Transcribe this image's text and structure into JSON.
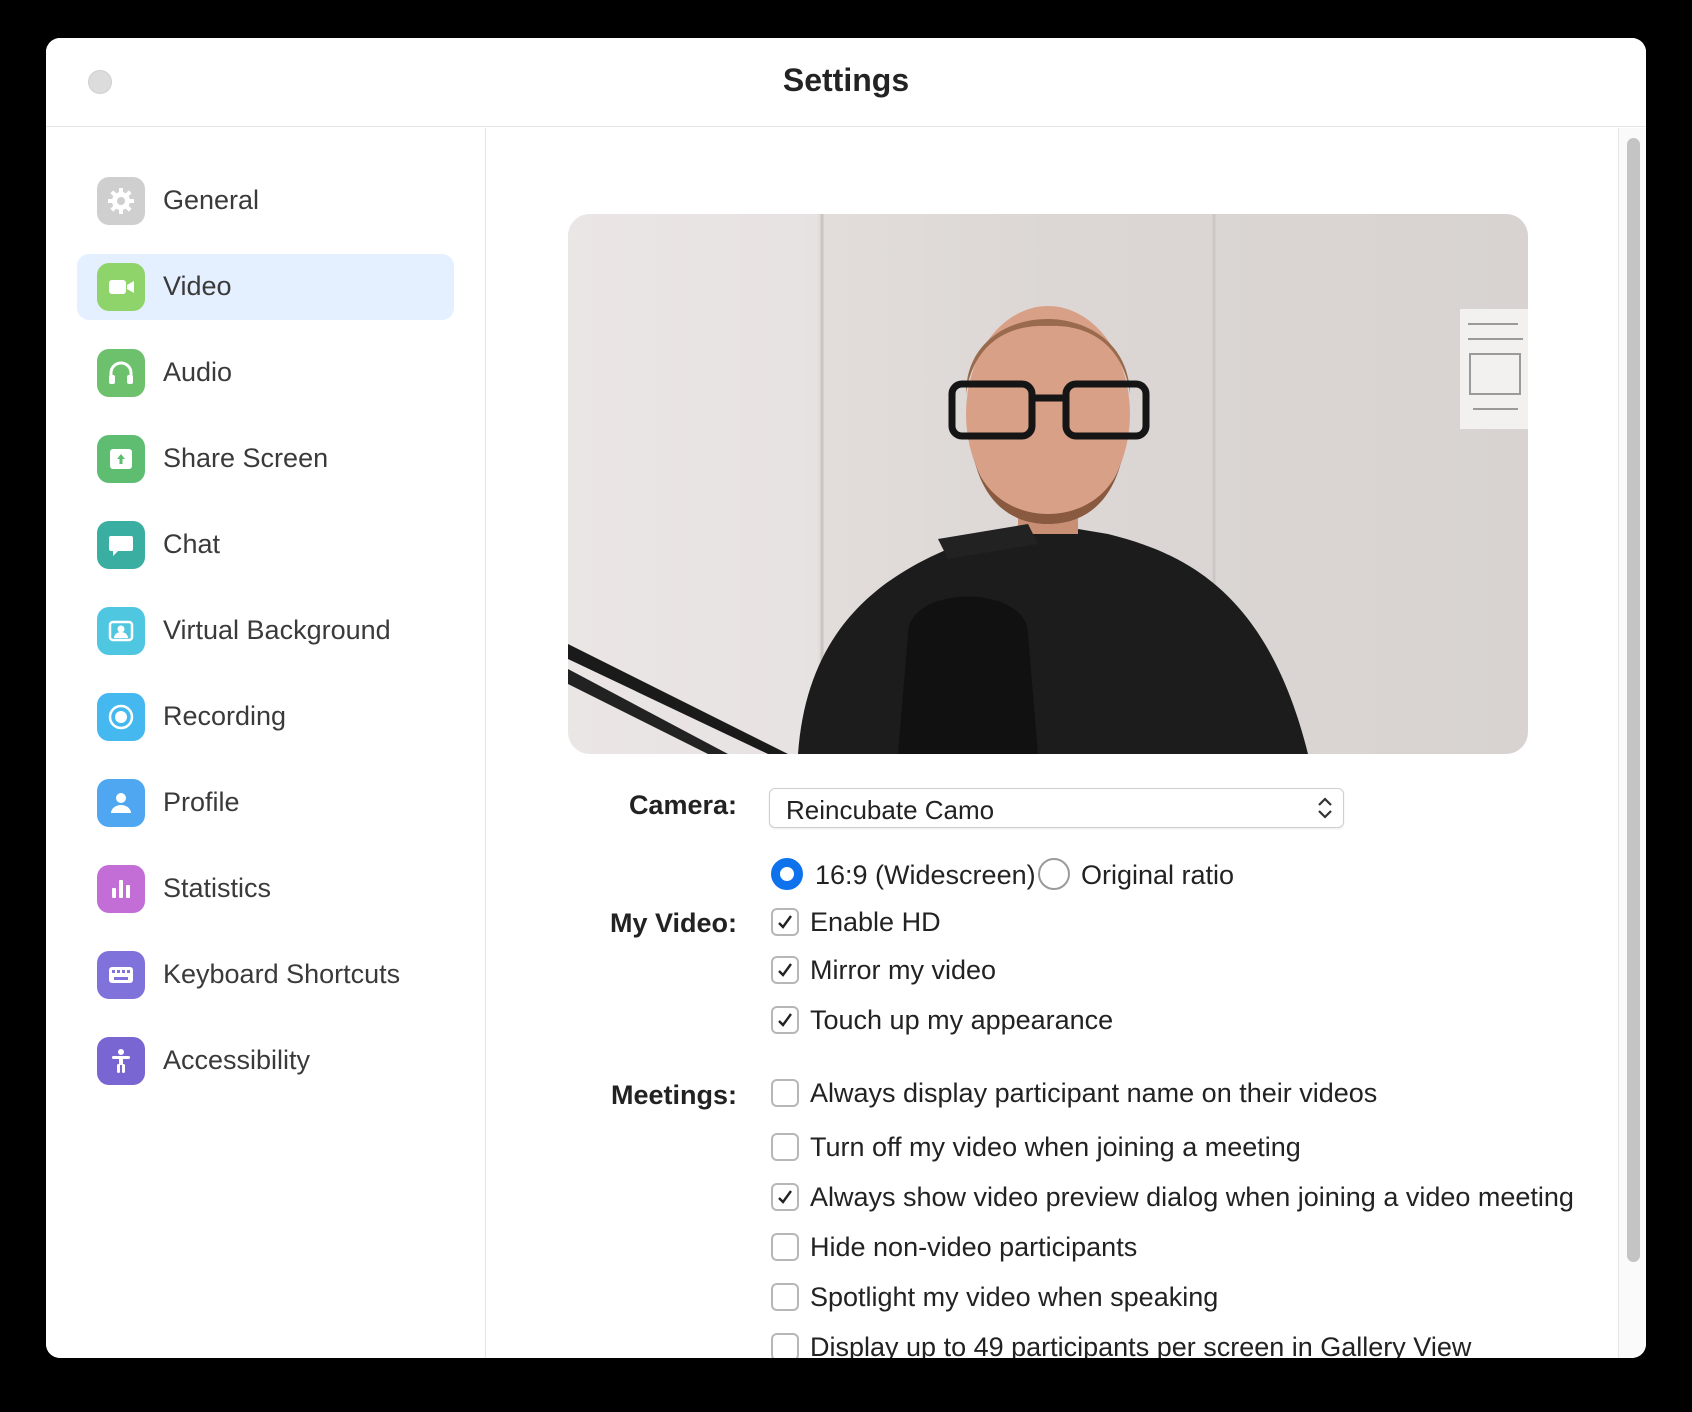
{
  "window": {
    "title": "Settings"
  },
  "sidebar": {
    "items": [
      {
        "label": "General",
        "icon": "gear-icon",
        "color": "#b9b9b9",
        "active": false
      },
      {
        "label": "Video",
        "icon": "video-camera-icon",
        "color": "#8fd46b",
        "active": true
      },
      {
        "label": "Audio",
        "icon": "headphones-icon",
        "color": "#6dc06c",
        "active": false
      },
      {
        "label": "Share Screen",
        "icon": "share-screen-icon",
        "color": "#5fbd71",
        "active": false
      },
      {
        "label": "Chat",
        "icon": "chat-bubble-icon",
        "color": "#3aaea0",
        "active": false
      },
      {
        "label": "Virtual Background",
        "icon": "virtual-background-icon",
        "color": "#4fc7e0",
        "active": false
      },
      {
        "label": "Recording",
        "icon": "record-icon",
        "color": "#45b9ef",
        "active": false
      },
      {
        "label": "Profile",
        "icon": "person-icon",
        "color": "#4ea7f0",
        "active": false
      },
      {
        "label": "Statistics",
        "icon": "bar-chart-icon",
        "color": "#c36ed6",
        "active": false
      },
      {
        "label": "Keyboard Shortcuts",
        "icon": "keyboard-icon",
        "color": "#7f72db",
        "active": false
      },
      {
        "label": "Accessibility",
        "icon": "accessibility-icon",
        "color": "#7a66d2",
        "active": false
      }
    ]
  },
  "video": {
    "camera_label": "Camera:",
    "camera_value": "Reincubate Camo",
    "ratio": {
      "widescreen_label": "16:9 (Widescreen)",
      "original_label": "Original ratio",
      "selected": "widescreen"
    },
    "my_video_label": "My Video:",
    "my_video_options": [
      {
        "label": "Enable HD",
        "checked": true
      },
      {
        "label": "Mirror my video",
        "checked": true
      },
      {
        "label": "Touch up my appearance",
        "checked": true
      }
    ],
    "meetings_label": "Meetings:",
    "meetings_options": [
      {
        "label": "Always display participant name on their videos",
        "checked": false
      },
      {
        "label": "Turn off my video when joining a meeting",
        "checked": false
      },
      {
        "label": "Always show video preview dialog when joining a video meeting",
        "checked": true
      },
      {
        "label": "Hide non-video participants",
        "checked": false
      },
      {
        "label": "Spotlight my video when speaking",
        "checked": false
      },
      {
        "label": "Display up to 49 participants per screen in Gallery View",
        "checked": false
      }
    ]
  },
  "colors": {
    "accent": "#0e72ed",
    "active_bg": "#e4efff"
  }
}
